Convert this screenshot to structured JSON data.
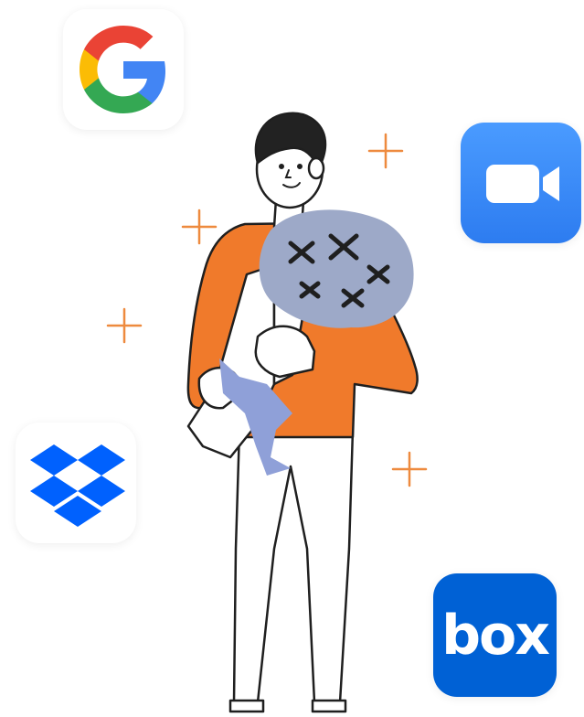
{
  "apps": {
    "google": {
      "icon": "google-g-logo",
      "colors": [
        "#4285F4",
        "#EA4335",
        "#FBBC05",
        "#34A853"
      ]
    },
    "zoom": {
      "icon": "video-camera-icon",
      "color": "#3D8BFA"
    },
    "dropbox": {
      "icon": "dropbox-logo",
      "color": "#0061FE"
    },
    "box": {
      "icon": "box-logo",
      "wordmark": "box",
      "color": "#0061D5"
    }
  },
  "illustration": {
    "subject": "person-holding-bouquet",
    "colors": {
      "shirt": "#F07A2B",
      "bouquet": "#9DA9C8",
      "ribbon": "#8FA0D8",
      "sparkle": "#EE8A3E",
      "outline": "#1F1F1F"
    }
  }
}
